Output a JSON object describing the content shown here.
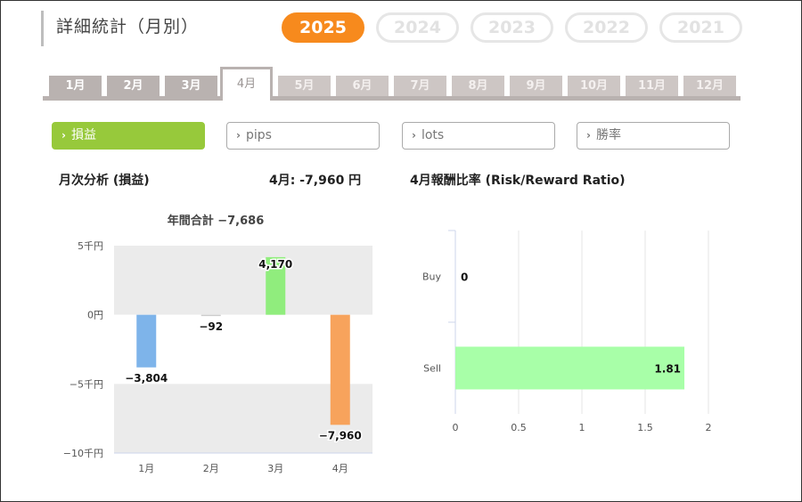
{
  "page": {
    "title": "詳細統計（月別）"
  },
  "years": [
    "2025",
    "2024",
    "2023",
    "2022",
    "2021"
  ],
  "active_year": "2025",
  "months": [
    "1月",
    "2月",
    "3月",
    "4月",
    "5月",
    "6月",
    "7月",
    "8月",
    "9月",
    "10月",
    "11月",
    "12月"
  ],
  "active_month": "4月",
  "metric_tabs": [
    {
      "label": "損益",
      "active": true
    },
    {
      "label": "pips",
      "active": false
    },
    {
      "label": "lots",
      "active": false
    },
    {
      "label": "勝率",
      "active": false
    }
  ],
  "chev_glyph": "›",
  "monthly_analysis": {
    "heading": "月次分析 (損益)",
    "current_value_label": "4月:  -7,960 円"
  },
  "rr_heading": "4月報酬比率 (Risk/Reward Ratio)",
  "colors": {
    "accent_orange": "#f78a1d",
    "accent_green": "#97c93b",
    "bar_blue": "#7eb4ea",
    "bar_green": "#90ed7d",
    "bar_orange": "#f7a35c",
    "bar_gray": "#cccccc",
    "rr_bar": "#a8ffa8"
  },
  "chart_data": [
    {
      "type": "bar",
      "title": "年間合計 −7,686",
      "categories": [
        "1月",
        "2月",
        "3月",
        "4月"
      ],
      "values": [
        -3804,
        -92,
        4170,
        -7960
      ],
      "data_labels": [
        "−3,804",
        "−92",
        "4,170",
        "−7,960"
      ],
      "y_ticks": [
        5000,
        0,
        -5000,
        -10000
      ],
      "y_tick_labels": [
        "5千円",
        "0円",
        "−5千円",
        "−10千円"
      ],
      "ylim": [
        -10000,
        5000
      ],
      "grid": "alternating bands",
      "legend": "none"
    },
    {
      "type": "bar",
      "orientation": "horizontal",
      "categories": [
        "Buy",
        "Sell"
      ],
      "values": [
        0,
        1.81
      ],
      "data_labels": [
        "0",
        "1.81"
      ],
      "x_ticks": [
        0,
        0.5,
        1,
        1.5,
        2
      ],
      "x_tick_labels": [
        "0",
        "0.5",
        "1",
        "1.5",
        "2"
      ],
      "xlim": [
        0,
        2
      ],
      "grid": "vertical lines",
      "legend": "none"
    }
  ]
}
